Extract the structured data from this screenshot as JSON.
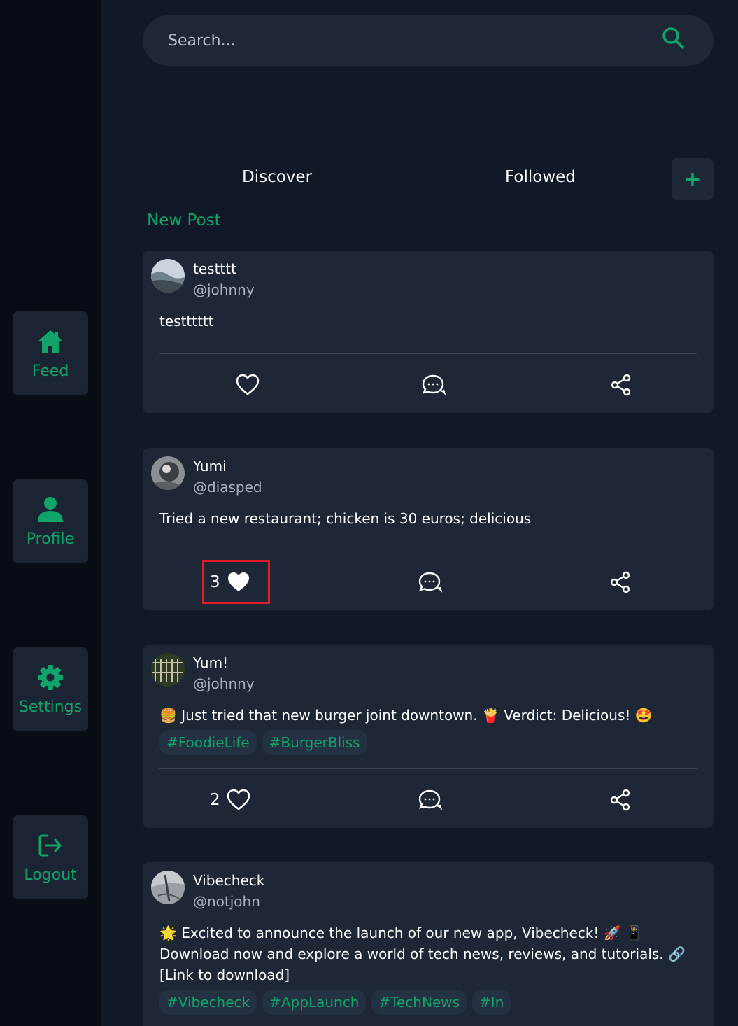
{
  "sidebar": {
    "items": [
      {
        "label": "Feed",
        "icon": "home-icon"
      },
      {
        "label": "Profile",
        "icon": "user-icon"
      },
      {
        "label": "Settings",
        "icon": "gear-icon"
      },
      {
        "label": "Logout",
        "icon": "logout-icon"
      }
    ]
  },
  "search": {
    "placeholder": "Search..."
  },
  "tabs": {
    "discover": "Discover",
    "followed": "Followed",
    "add": "+"
  },
  "new_post": "New Post",
  "posts": [
    {
      "name": "testttt",
      "handle": "@johnny",
      "text": "testttttt",
      "likes": "",
      "tags": []
    },
    {
      "name": "Yumi",
      "handle": "@diasped",
      "text": "Tried a new restaurant; chicken is 30 euros; delicious",
      "likes": "3",
      "liked": true,
      "tags": []
    },
    {
      "name": "Yum!",
      "handle": "@johnny",
      "text": "🍔 Just tried that new burger joint downtown. 🍟 Verdict: Delicious! 🤩",
      "likes": "2",
      "tags": [
        "#FoodieLife",
        "#BurgerBliss"
      ]
    },
    {
      "name": "Vibecheck",
      "handle": "@notjohn",
      "text": "🌟 Excited to announce the launch of our new app, Vibecheck! 🚀 📱 Download now and explore a world of tech news, reviews, and tutorials. 🔗 [Link to download]",
      "tags": [
        "#Vibecheck",
        "#AppLaunch",
        "#TechNews",
        "#In"
      ]
    }
  ],
  "colors": {
    "accent": "#10a36a",
    "background": "#111827",
    "card": "#1e2736",
    "highlight": "#e11d2a"
  }
}
